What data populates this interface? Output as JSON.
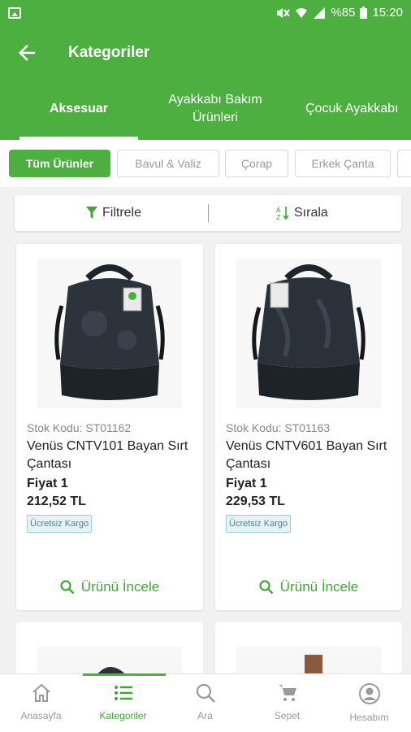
{
  "status_bar": {
    "battery": "%85",
    "time": "15:20"
  },
  "app_bar": {
    "title": "Kategoriler"
  },
  "tabs": [
    {
      "label": "Aksesuar"
    },
    {
      "label": "Ayakkabı Bakım Ürünleri"
    },
    {
      "label": "Çocuk Ayakkabı"
    }
  ],
  "chips": [
    {
      "label": "Tüm Ürünler"
    },
    {
      "label": "Bavul & Valiz"
    },
    {
      "label": "Çorap"
    },
    {
      "label": "Erkek Çanta"
    }
  ],
  "toolbar": {
    "filter_label": "Filtrele",
    "sort_label": "Sırala"
  },
  "products": [
    {
      "stock": "Stok Kodu: ST01162",
      "name": "Venüs CNTV101 Bayan Sırt Çantası",
      "price_level": "Fiyat 1",
      "price": "212,52 TL",
      "badge": "Ücretsiz Kargo",
      "action": "Ürünü İncele"
    },
    {
      "stock": "Stok Kodu: ST01163",
      "name": "Venüs CNTV601 Bayan Sırt Çantası",
      "price_level": "Fiyat 1",
      "price": "229,53 TL",
      "badge": "Ücretsiz Kargo",
      "action": "Ürünü İncele"
    }
  ],
  "bottom_nav": [
    {
      "label": "Anasayfa",
      "icon": "home-icon"
    },
    {
      "label": "Kategoriler",
      "icon": "list-icon"
    },
    {
      "label": "Ara",
      "icon": "search-icon"
    },
    {
      "label": "Sepet",
      "icon": "cart-icon"
    },
    {
      "label": "Hesabım",
      "icon": "account-icon"
    }
  ],
  "colors": {
    "brand": "#4caf3f",
    "action": "#43a33a",
    "badge_bg": "#e4f3f6"
  }
}
